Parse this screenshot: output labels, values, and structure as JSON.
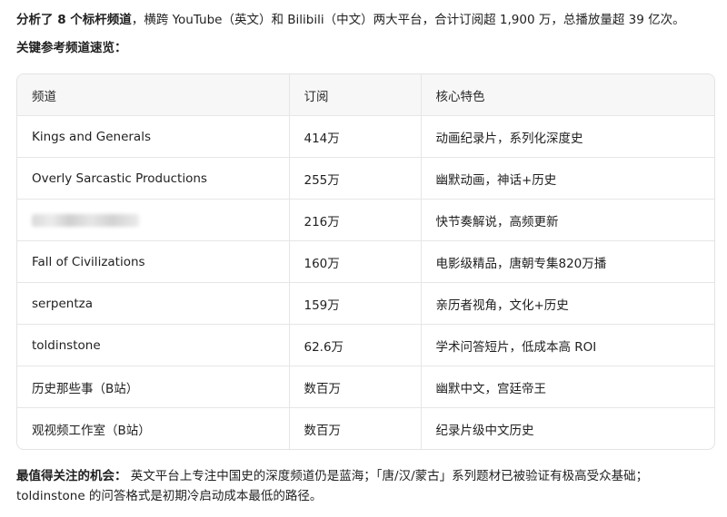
{
  "intro": {
    "lead_bold": "分析了 8 个标杆频道",
    "rest": "，横跨 YouTube（英文）和 Bilibili（中文）两大平台，合计订阅超 1,900 万，总播放量超 39 亿次。"
  },
  "heading": "关键参考频道速览：",
  "table": {
    "headers": [
      "频道",
      "订阅",
      "核心特色"
    ],
    "rows": [
      {
        "channel": "Kings and Generals",
        "subs": "414万",
        "feature": "动画纪录片，系列化深度史"
      },
      {
        "channel": "Overly Sarcastic Productions",
        "subs": "255万",
        "feature": "幽默动画，神话+历史"
      },
      {
        "channel": "",
        "subs": "216万",
        "feature": "快节奏解说，高频更新",
        "redacted": true
      },
      {
        "channel": "Fall of Civilizations",
        "subs": "160万",
        "feature": "电影级精品，唐朝专集820万播"
      },
      {
        "channel": "serpentza",
        "subs": "159万",
        "feature": "亲历者视角，文化+历史"
      },
      {
        "channel": "toldinstone",
        "subs": "62.6万",
        "feature": "学术问答短片，低成本高 ROI"
      },
      {
        "channel": "历史那些事（B站）",
        "subs": "数百万",
        "feature": "幽默中文，宫廷帝王"
      },
      {
        "channel": "观视频工作室（B站）",
        "subs": "数百万",
        "feature": "纪录片级中文历史"
      }
    ]
  },
  "footer": {
    "label": "最值得关注的机会：",
    "line1": "英文平台上专注中国史的深度频道仍是蓝海；「唐/汉/蒙古」系列题材已被验证有极高受众基础；",
    "line2": "toldinstone 的问答格式是初期冷启动成本最低的路径。"
  }
}
